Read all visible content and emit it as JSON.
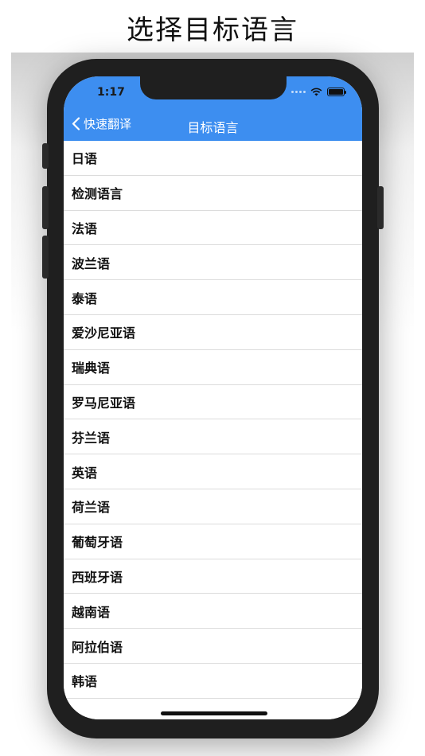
{
  "headline": "选择目标语言",
  "status": {
    "time": "1:17"
  },
  "navbar": {
    "back_label": "快速翻译",
    "title": "目标语言",
    "color": "#3d8ef0"
  },
  "languages": [
    "日语",
    "检测语言",
    "法语",
    "波兰语",
    "泰语",
    "爱沙尼亚语",
    "瑞典语",
    "罗马尼亚语",
    "芬兰语",
    "英语",
    "荷兰语",
    "葡萄牙语",
    "西班牙语",
    "越南语",
    "阿拉伯语",
    "韩语"
  ]
}
